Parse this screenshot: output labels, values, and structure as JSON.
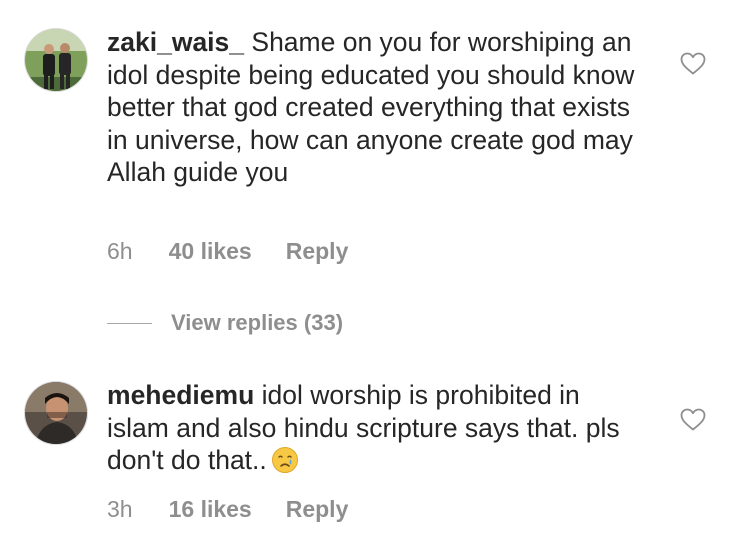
{
  "comments": [
    {
      "username": "zaki_wais_",
      "text": " Shame on you for worshiping an idol despite being educated you should know better that god created everything that exists in universe, how can anyone create god may Allah guide you",
      "time": "6h",
      "likes": "40 likes",
      "reply_label": "Reply",
      "view_replies": "View replies (33)",
      "avatar_icon": "avatar-two-people-photo"
    },
    {
      "username": "mehediemu",
      "text": " idol worship is prohibited in islam and also hindu scripture says that. pls don't do that..",
      "emoji": "crying-face-emoji",
      "time": "3h",
      "likes": "16 likes",
      "reply_label": "Reply",
      "avatar_icon": "avatar-person-photo"
    }
  ],
  "colors": {
    "text": "#262626",
    "secondary": "#8e8e8e",
    "divider": "#a8a8a8",
    "background": "#ffffff"
  }
}
